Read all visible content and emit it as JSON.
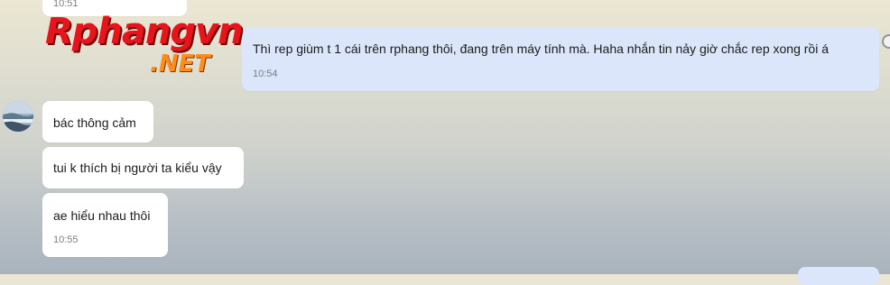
{
  "previous_message": {
    "time": "10:51"
  },
  "watermark": {
    "main": "Rphangvn",
    "sub": ".NET"
  },
  "sent_message": {
    "text": "Thì rep giùm t 1 cái trên rphang thôi, đang trên máy tính mà. Haha nhắn tin nảy giờ chắc rep xong rồi á",
    "time": "10:54"
  },
  "received_messages": [
    {
      "text": "bác thông cảm"
    },
    {
      "text": "tui k thích bị người ta kiểu vậy"
    },
    {
      "text": "ae hiểu nhau thôi",
      "time": "10:55"
    }
  ],
  "colors": {
    "sent_bubble": "#dbe6fa",
    "received_bubble": "#ffffff",
    "timestamp": "#7a7f86",
    "logo_red": "#e8141b",
    "logo_orange": "#ff8c1a"
  },
  "icons": {
    "avatar": "avatar-landscape-icon"
  }
}
